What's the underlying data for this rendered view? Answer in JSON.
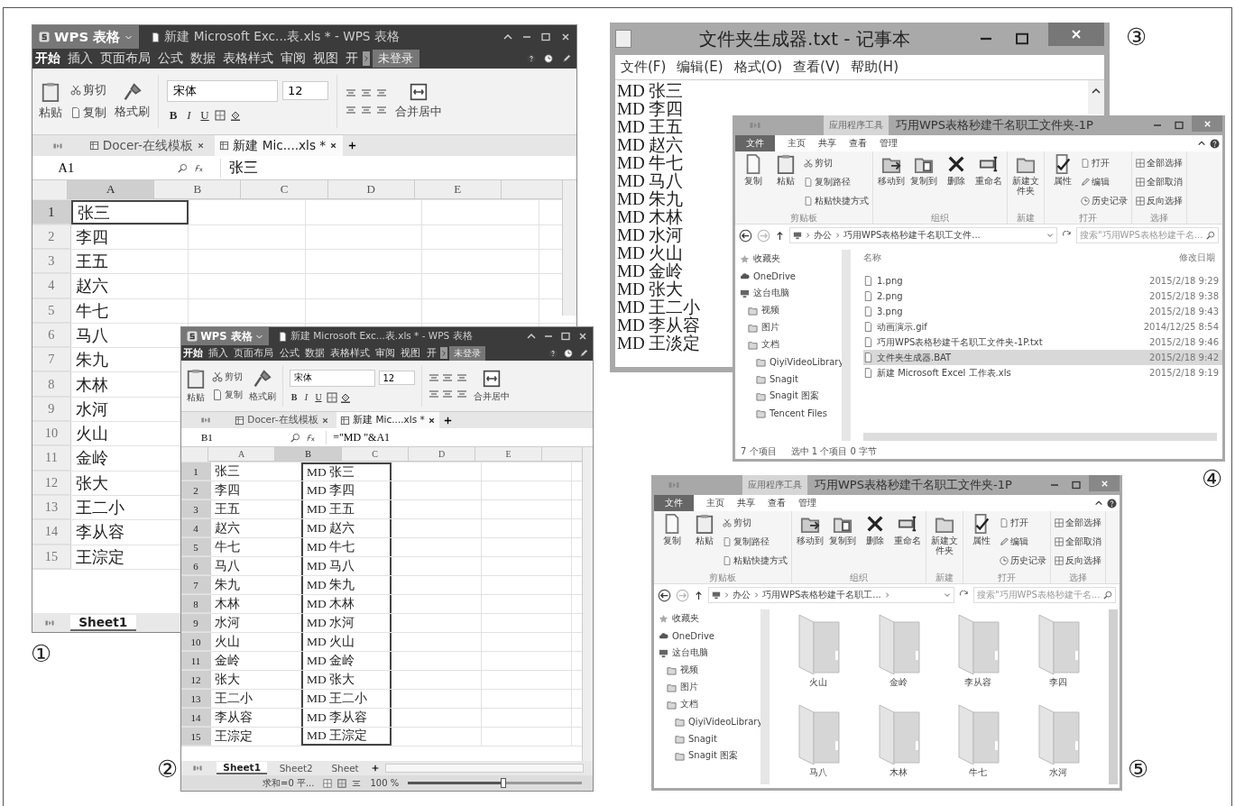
{
  "wps_windows": [
    {
      "app_name": "WPS 表格",
      "title": "新建 Microsoft Exc...表.xls * - WPS 表格",
      "menu": [
        {
          "label": "开始",
          "selected": true
        },
        {
          "label": "插入",
          "selected": false
        },
        {
          "label": "页面布局",
          "selected": false
        },
        {
          "label": "公式",
          "selected": false
        },
        {
          "label": "数据",
          "selected": false
        },
        {
          "label": "表格样式",
          "selected": false
        },
        {
          "label": "审阅",
          "selected": false
        },
        {
          "label": "视图",
          "selected": false
        },
        {
          "label": "开",
          "selected": false
        }
      ],
      "login": "未登录",
      "ribbon": {
        "paste": "粘贴",
        "cut": "剪切",
        "copy": "复制",
        "format_painter": "格式刷",
        "font": "宋体",
        "font_size": "12",
        "format_buttons": [
          "B",
          "I",
          "U"
        ],
        "merge": "合并居中"
      },
      "doc_tabs": [
        {
          "label": "Docer-在线模板",
          "selected": false
        },
        {
          "label": "新建 Mic....xls *",
          "selected": true
        }
      ],
      "name_box": "A1",
      "formula": "张三",
      "columns": [
        {
          "label": "A",
          "selected": true
        },
        {
          "label": "B",
          "selected": false
        },
        {
          "label": "C",
          "selected": false
        },
        {
          "label": "D",
          "selected": false
        },
        {
          "label": "E",
          "selected": false
        }
      ],
      "rows": [
        {
          "number": "1",
          "selected": true,
          "cells": [
            "张三"
          ]
        },
        {
          "number": "2",
          "selected": false,
          "cells": [
            "李四"
          ]
        },
        {
          "number": "3",
          "selected": false,
          "cells": [
            "王五"
          ]
        },
        {
          "number": "4",
          "selected": false,
          "cells": [
            "赵六"
          ]
        },
        {
          "number": "5",
          "selected": false,
          "cells": [
            "牛七"
          ]
        },
        {
          "number": "6",
          "selected": false,
          "cells": [
            "马八"
          ]
        },
        {
          "number": "7",
          "selected": false,
          "cells": [
            "朱九"
          ]
        },
        {
          "number": "8",
          "selected": false,
          "cells": [
            "木林"
          ]
        },
        {
          "number": "9",
          "selected": false,
          "cells": [
            "水河"
          ]
        },
        {
          "number": "10",
          "selected": false,
          "cells": [
            "火山"
          ]
        },
        {
          "number": "11",
          "selected": false,
          "cells": [
            "金岭"
          ]
        },
        {
          "number": "12",
          "selected": false,
          "cells": [
            "张大"
          ]
        },
        {
          "number": "13",
          "selected": false,
          "cells": [
            "王二小"
          ]
        },
        {
          "number": "14",
          "selected": false,
          "cells": [
            "李从容"
          ]
        },
        {
          "number": "15",
          "selected": false,
          "cells": [
            "王淙定"
          ]
        }
      ],
      "sheet_tabs": [
        {
          "label": "Sheet1",
          "selected": true
        }
      ]
    },
    {
      "app_name": "WPS 表格",
      "title": "新建 Microsoft Exc...表.xls * - WPS 表格",
      "menu": [
        {
          "label": "开始",
          "selected": true
        },
        {
          "label": "插入",
          "selected": false
        },
        {
          "label": "页面布局",
          "selected": false
        },
        {
          "label": "公式",
          "selected": false
        },
        {
          "label": "数据",
          "selected": false
        },
        {
          "label": "表格样式",
          "selected": false
        },
        {
          "label": "审阅",
          "selected": false
        },
        {
          "label": "视图",
          "selected": false
        },
        {
          "label": "开",
          "selected": false
        }
      ],
      "login": "未登录",
      "ribbon": {
        "paste": "粘贴",
        "cut": "剪切",
        "copy": "复制",
        "format_painter": "格式刷",
        "font": "宋体",
        "font_size": "12",
        "format_buttons": [
          "B",
          "I",
          "U"
        ],
        "merge": "合并居中"
      },
      "doc_tabs": [
        {
          "label": "Docer-在线模板",
          "selected": false
        },
        {
          "label": "新建 Mic....xls *",
          "selected": true
        }
      ],
      "name_box": "B1",
      "formula": "=\"MD \"&A1",
      "columns": [
        {
          "label": "A",
          "selected": false
        },
        {
          "label": "B",
          "selected": true
        },
        {
          "label": "C",
          "selected": false
        },
        {
          "label": "D",
          "selected": false
        },
        {
          "label": "E",
          "selected": false
        }
      ],
      "rows": [
        {
          "number": "1",
          "selected": true,
          "cells": [
            "张三",
            "MD 张三"
          ]
        },
        {
          "number": "2",
          "selected": true,
          "cells": [
            "李四",
            "MD 李四"
          ]
        },
        {
          "number": "3",
          "selected": true,
          "cells": [
            "王五",
            "MD 王五"
          ]
        },
        {
          "number": "4",
          "selected": true,
          "cells": [
            "赵六",
            "MD 赵六"
          ]
        },
        {
          "number": "5",
          "selected": true,
          "cells": [
            "牛七",
            "MD 牛七"
          ]
        },
        {
          "number": "6",
          "selected": true,
          "cells": [
            "马八",
            "MD 马八"
          ]
        },
        {
          "number": "7",
          "selected": true,
          "cells": [
            "朱九",
            "MD 朱九"
          ]
        },
        {
          "number": "8",
          "selected": true,
          "cells": [
            "木林",
            "MD 木林"
          ]
        },
        {
          "number": "9",
          "selected": true,
          "cells": [
            "水河",
            "MD 水河"
          ]
        },
        {
          "number": "10",
          "selected": true,
          "cells": [
            "火山",
            "MD 火山"
          ]
        },
        {
          "number": "11",
          "selected": true,
          "cells": [
            "金岭",
            "MD 金岭"
          ]
        },
        {
          "number": "12",
          "selected": true,
          "cells": [
            "张大",
            "MD 张大"
          ]
        },
        {
          "number": "13",
          "selected": true,
          "cells": [
            "王二小",
            "MD 王二小"
          ]
        },
        {
          "number": "14",
          "selected": true,
          "cells": [
            "李从容",
            "MD 李从容"
          ]
        },
        {
          "number": "15",
          "selected": true,
          "cells": [
            "王淙定",
            "MD 王淙定"
          ]
        }
      ],
      "sheet_tabs": [
        {
          "label": "Sheet1",
          "selected": true
        },
        {
          "label": "Sheet2",
          "selected": false
        },
        {
          "label": "Sheet",
          "selected": false
        }
      ],
      "status": {
        "sum": "求和=0 平...",
        "zoom": "100 %",
        "level": 0.55
      }
    }
  ],
  "notepad": {
    "title": "文件夹生成器.txt - 记事本",
    "menu": [
      "文件(F)",
      "编辑(E)",
      "格式(O)",
      "查看(V)",
      "帮助(H)"
    ],
    "lines": [
      "MD 张三",
      "MD 李四",
      "MD 王五",
      "MD 赵六",
      "MD 牛七",
      "MD 马八",
      "MD 朱九",
      "MD 木林",
      "MD 水河",
      "MD 火山",
      "MD 金岭",
      "MD 张大",
      "MD 王二小",
      "MD 李从容",
      "MD 王淡定"
    ]
  },
  "explorer_windows": [
    {
      "kind": "details",
      "context_tab": "应用程序工具",
      "title": "巧用WPS表格秒建千名职工文件夹-1P",
      "file_tab": "文件",
      "ribbon_tabs": [
        "主页",
        "共享",
        "查看",
        "管理"
      ],
      "ribbon_groups": [
        {
          "label": "剪贴板",
          "buttons": [
            {
              "label": "复制",
              "kind": "large"
            },
            {
              "label": "粘贴",
              "kind": "large"
            },
            {
              "label": "剪切",
              "kind": "small"
            },
            {
              "label": "复制路径",
              "kind": "small"
            },
            {
              "label": "粘贴快捷方式",
              "kind": "small"
            }
          ]
        },
        {
          "label": "组织",
          "buttons": [
            {
              "label": "移动到",
              "kind": "large"
            },
            {
              "label": "复制到",
              "kind": "large"
            },
            {
              "label": "删除",
              "kind": "large"
            },
            {
              "label": "重命名",
              "kind": "large"
            }
          ]
        },
        {
          "label": "新建",
          "buttons": [
            {
              "label": "新建文件夹",
              "kind": "large"
            }
          ]
        },
        {
          "label": "打开",
          "buttons": [
            {
              "label": "属性",
              "kind": "large"
            },
            {
              "label": "打开",
              "kind": "small"
            },
            {
              "label": "编辑",
              "kind": "small"
            },
            {
              "label": "历史记录",
              "kind": "small"
            }
          ]
        },
        {
          "label": "选择",
          "buttons": [
            {
              "label": "全部选择",
              "kind": "small"
            },
            {
              "label": "全部取消",
              "kind": "small"
            },
            {
              "label": "反向选择",
              "kind": "small"
            }
          ]
        }
      ],
      "address": [
        "办公",
        "巧用WPS表格秒建千名职工文件..."
      ],
      "search_placeholder": "搜索\"巧用WPS表格秒建千名...",
      "nav": [
        {
          "label": "收藏夹"
        },
        {
          "label": "OneDrive"
        },
        {
          "label": "这台电脑",
          "children": [
            {
              "label": "视频"
            },
            {
              "label": "图片"
            },
            {
              "label": "文档",
              "children": [
                {
                  "label": "QiyiVideoLibrary"
                },
                {
                  "label": "Snagit"
                },
                {
                  "label": "Snagit 图案"
                },
                {
                  "label": "Tencent Files"
                }
              ]
            }
          ]
        }
      ],
      "columns": [
        "名称",
        "修改日期"
      ],
      "files": [
        {
          "name": "1.png",
          "modified": "2015/2/18 9:29",
          "selected": false
        },
        {
          "name": "2.png",
          "modified": "2015/2/18 9:38",
          "selected": false
        },
        {
          "name": "3.png",
          "modified": "2015/2/18 9:43",
          "selected": false
        },
        {
          "name": "动画演示.gif",
          "modified": "2014/12/25 8:54",
          "selected": false
        },
        {
          "name": "巧用WPS表格秒建千名职工文件夹-1P.txt",
          "modified": "2015/2/18 9:46",
          "selected": false
        },
        {
          "name": "文件夹生成器.BAT",
          "modified": "2015/2/18 9:42",
          "selected": true
        },
        {
          "name": "新建 Microsoft Excel 工作表.xls",
          "modified": "2015/2/18 9:19",
          "selected": false
        }
      ],
      "status": [
        "7 个项目",
        "选中 1 个项目 0 字节"
      ]
    },
    {
      "kind": "icons",
      "context_tab": "应用程序工具",
      "title": "巧用WPS表格秒建千名职工文件夹-1P",
      "file_tab": "文件",
      "ribbon_tabs": [
        "主页",
        "共享",
        "查看",
        "管理"
      ],
      "ribbon_groups": [
        {
          "label": "剪贴板",
          "buttons": [
            {
              "label": "复制",
              "kind": "large"
            },
            {
              "label": "粘贴",
              "kind": "large"
            },
            {
              "label": "剪切",
              "kind": "small"
            },
            {
              "label": "复制路径",
              "kind": "small"
            },
            {
              "label": "粘贴快捷方式",
              "kind": "small"
            }
          ]
        },
        {
          "label": "组织",
          "buttons": [
            {
              "label": "移动到",
              "kind": "large"
            },
            {
              "label": "复制到",
              "kind": "large"
            },
            {
              "label": "删除",
              "kind": "large"
            },
            {
              "label": "重命名",
              "kind": "large"
            }
          ]
        },
        {
          "label": "新建",
          "buttons": [
            {
              "label": "新建文件夹",
              "kind": "large"
            }
          ]
        },
        {
          "label": "打开",
          "buttons": [
            {
              "label": "属性",
              "kind": "large"
            },
            {
              "label": "打开",
              "kind": "small"
            },
            {
              "label": "编辑",
              "kind": "small"
            },
            {
              "label": "历史记录",
              "kind": "small"
            }
          ]
        },
        {
          "label": "选择",
          "buttons": [
            {
              "label": "全部选择",
              "kind": "small"
            },
            {
              "label": "全部取消",
              "kind": "small"
            },
            {
              "label": "反向选择",
              "kind": "small"
            }
          ]
        }
      ],
      "address": [
        "办公",
        "巧用WPS表格秒建千名职工..."
      ],
      "search_placeholder": "搜索\"巧用WPS表格秒建千名...",
      "nav": [
        {
          "label": "收藏夹"
        },
        {
          "label": "OneDrive"
        },
        {
          "label": "这台电脑",
          "children": [
            {
              "label": "视频"
            },
            {
              "label": "图片"
            },
            {
              "label": "文档",
              "children": [
                {
                  "label": "QiyiVideoLibrary"
                },
                {
                  "label": "Snagit"
                },
                {
                  "label": "Snagit 图案"
                }
              ]
            }
          ]
        }
      ],
      "folders": [
        "火山",
        "金岭",
        "李从容",
        "李四",
        "马八",
        "木林",
        "牛七",
        "水河"
      ]
    }
  ],
  "figure_labels": [
    "①",
    "②",
    "③",
    "④",
    "⑤"
  ]
}
